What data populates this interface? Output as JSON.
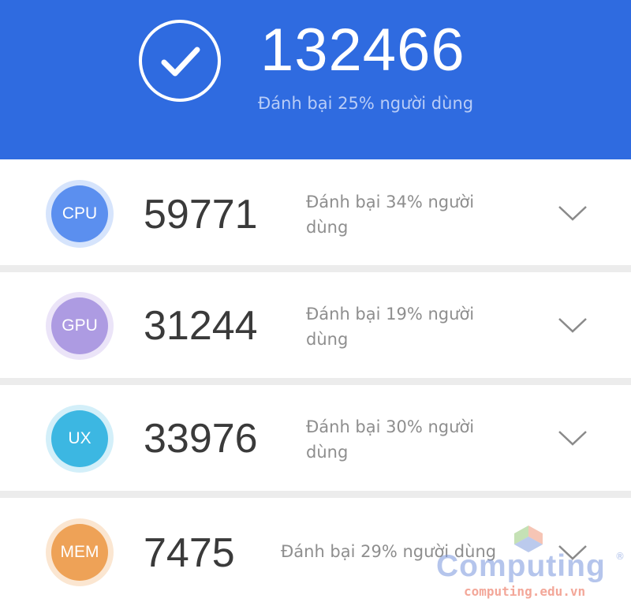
{
  "header": {
    "total_score": "132466",
    "subtitle": "Đánh bại 25% người dùng",
    "color": "#2f6be0"
  },
  "items": [
    {
      "label": "CPU",
      "score": "59771",
      "desc": "Đánh bại 34% người dùng",
      "color": "#5b8fef",
      "ring": "#d6e4fc"
    },
    {
      "label": "GPU",
      "score": "31244",
      "desc": "Đánh bại 19% người dùng",
      "color": "#ad9be2",
      "ring": "#ebe4f8"
    },
    {
      "label": "UX",
      "score": "33976",
      "desc": "Đánh bại 30% người dùng",
      "color": "#3cb7e2",
      "ring": "#d3eff9"
    },
    {
      "label": "MEM",
      "score": "7475",
      "desc": "Đánh bại 29% người dùng",
      "color": "#eea257",
      "ring": "#fbe6d1"
    }
  ],
  "watermark": {
    "brand": "Computing",
    "registered": "®",
    "url": "computing.edu.vn"
  }
}
